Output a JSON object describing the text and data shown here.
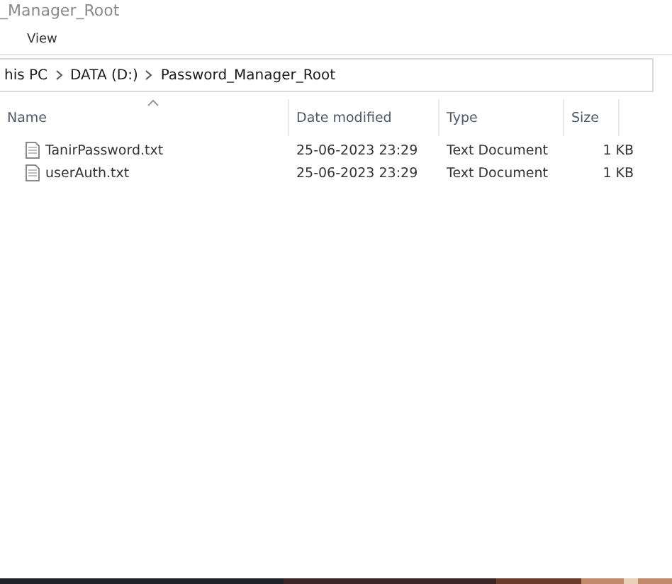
{
  "window": {
    "title": "_Manager_Root"
  },
  "ribbon": {
    "tabs": [
      {
        "label": "View"
      }
    ]
  },
  "breadcrumb": [
    "his PC",
    "DATA (D:)",
    "Password_Manager_Root"
  ],
  "table": {
    "columns": [
      "Name",
      "Date modified",
      "Type",
      "Size"
    ],
    "rows": [
      {
        "name": "TanirPassword.txt",
        "date": "25-06-2023 23:29",
        "type": "Text Document",
        "size": "1 KB"
      },
      {
        "name": "userAuth.txt",
        "date": "25-06-2023 23:29",
        "type": "Text Document",
        "size": "1 KB"
      }
    ]
  }
}
